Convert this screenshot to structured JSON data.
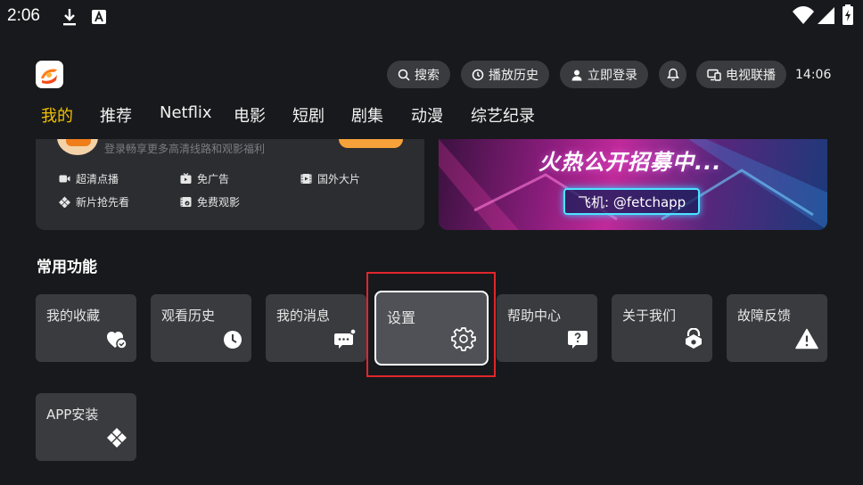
{
  "status_bar": {
    "time": "2:06"
  },
  "header": {
    "search_label": "搜索",
    "history_label": "播放历史",
    "login_label": "立即登录",
    "tv_link_label": "电视联播",
    "clock": "14:06"
  },
  "nav": {
    "items": [
      "我的",
      "推荐",
      "Netflix",
      "电影",
      "短剧",
      "剧集",
      "动漫",
      "综艺纪录"
    ],
    "active_index": 0
  },
  "account_card": {
    "subtitle": "登录畅享更多高清线路和观影福利",
    "perks": [
      "超清点播",
      "免广告",
      "国外大片",
      "新片抢先看",
      "免费观影"
    ]
  },
  "banner": {
    "title": "火热公开招募中...",
    "tag": "飞机: @fetchapp"
  },
  "functions": {
    "title": "常用功能",
    "tiles": [
      {
        "label": "我的收藏",
        "icon": "heart-check-icon"
      },
      {
        "label": "观看历史",
        "icon": "clock-icon"
      },
      {
        "label": "我的消息",
        "icon": "message-icon"
      },
      {
        "label": "设置",
        "icon": "gear-icon"
      },
      {
        "label": "帮助中心",
        "icon": "help-icon"
      },
      {
        "label": "关于我们",
        "icon": "info-home-icon"
      },
      {
        "label": "故障反馈",
        "icon": "warning-icon"
      },
      {
        "label": "APP安装",
        "icon": "app-install-icon"
      }
    ],
    "focused_index": 3
  },
  "colors": {
    "accent": "#f2c200",
    "focus_outline": "#e0262b",
    "tile_bg": "#3a3b3f",
    "background": "#18191c"
  }
}
